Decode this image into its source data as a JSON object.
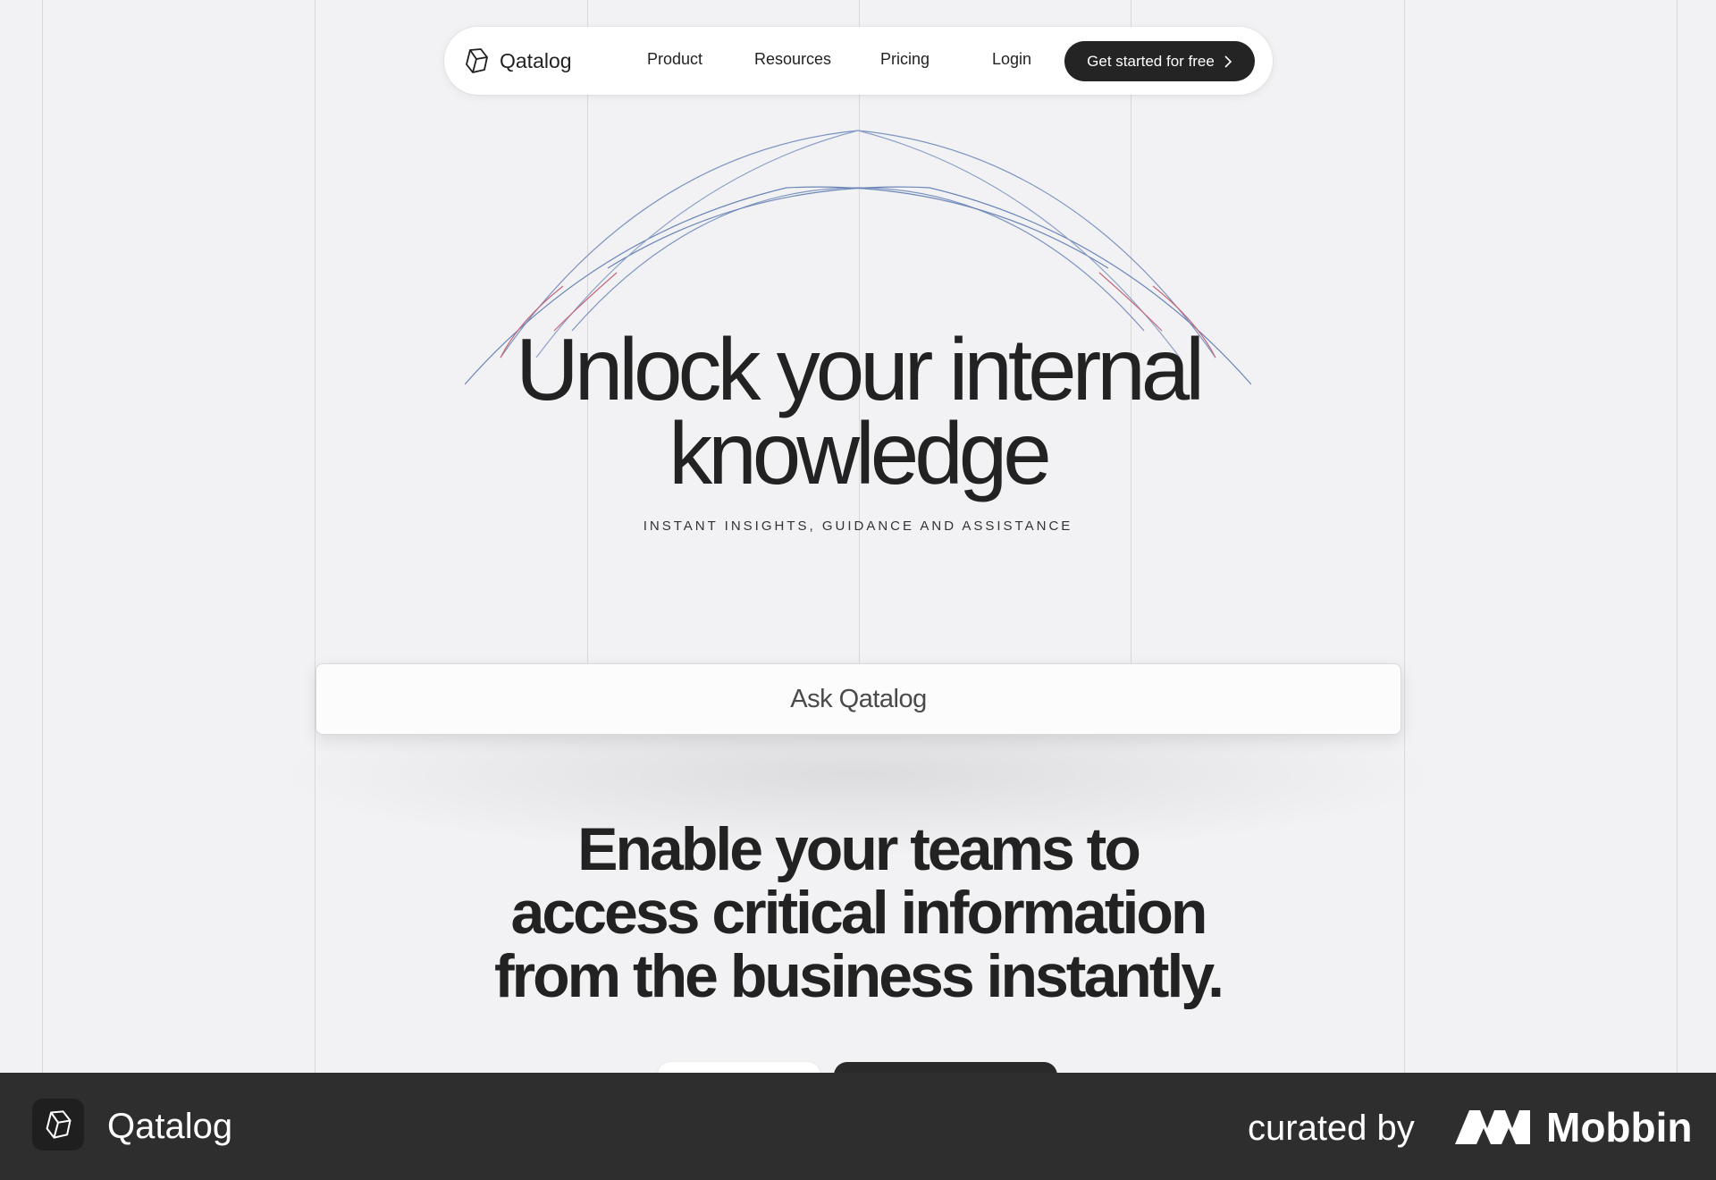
{
  "nav": {
    "logo_text": "Qatalog",
    "logo_icon": "qatalog-hexagon-icon",
    "links": [
      "Product",
      "Resources",
      "Pricing"
    ],
    "login": "Login",
    "cta_label": "Get started for free",
    "cta_icon": "chevron-right-icon"
  },
  "hero": {
    "title_line1": "Unlock your internal",
    "title_line2": "knowledge",
    "subtitle": "INSTANT INSIGHTS, GUIDANCE AND ASSISTANCE"
  },
  "ask": {
    "label": "Ask Qatalog"
  },
  "section": {
    "line1": "Enable your teams to",
    "line2": "access critical information",
    "line3": "from the business instantly."
  },
  "footer": {
    "app_name": "Qatalog",
    "curated_by": "curated by",
    "brand": "Mobbin"
  },
  "colors": {
    "background": "#f2f2f4",
    "dark": "#242424",
    "arc_blue": "#6b86b8",
    "arc_red": "#c4697a",
    "footer_bg": "#2e2e2e"
  }
}
